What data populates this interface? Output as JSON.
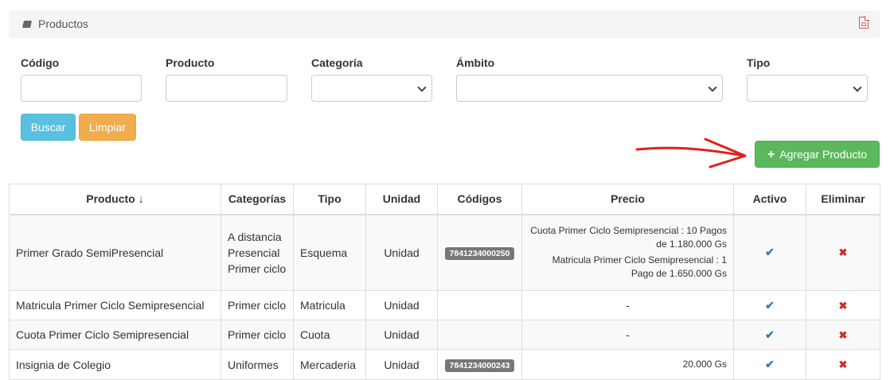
{
  "panel": {
    "title": "Productos",
    "title_icon": "book-icon",
    "export_icon": "file-pdf-icon"
  },
  "filters": {
    "codigo_label": "Código",
    "producto_label": "Producto",
    "categoria_label": "Categoría",
    "ambito_label": "Ámbito",
    "tipo_label": "Tipo",
    "codigo_value": "",
    "producto_value": "",
    "categoria_value": "",
    "ambito_value": "",
    "tipo_value": ""
  },
  "actions": {
    "buscar_label": "Buscar",
    "limpiar_label": "Limpiar",
    "agregar_label": "Agregar Producto",
    "agregar_icon": "plus-icon"
  },
  "annotation": {
    "arrow_color": "#e0201a"
  },
  "colors": {
    "buscar": "#5bc0de",
    "limpiar": "#f0ad4e",
    "agregar": "#5cb85c",
    "badge": "#777777",
    "check": "#337ab7",
    "delete": "#c9302c"
  },
  "table": {
    "headers": {
      "producto": "Producto",
      "producto_sort_icon": "arrow-down-icon",
      "categorias": "Categorías",
      "tipo": "Tipo",
      "unidad": "Unidad",
      "codigos": "Códigos",
      "precio": "Precio",
      "activo": "Activo",
      "eliminar": "Eliminar"
    },
    "rows": [
      {
        "producto": "Primer Grado SemiPresencial",
        "categorias": [
          "A distancia",
          "Presencial",
          "Primer ciclo"
        ],
        "tipo": "Esquema",
        "unidad": "Unidad",
        "codigo": "7841234000250",
        "precio": [
          "Cuota Primer Ciclo Semipresencial : 10 Pagos de 1.180.000 Gs",
          "Matricula Primer Ciclo Semipresencial : 1 Pago de 1.650.000 Gs"
        ]
      },
      {
        "producto": "Matricula Primer Ciclo Semipresencial",
        "categorias": [
          "Primer ciclo"
        ],
        "tipo": "Matricula",
        "unidad": "Unidad",
        "codigo": "",
        "precio": [
          "-"
        ]
      },
      {
        "producto": "Cuota Primer Ciclo Semipresencial",
        "categorias": [
          "Primer ciclo"
        ],
        "tipo": "Cuota",
        "unidad": "Unidad",
        "codigo": "",
        "precio": [
          "-"
        ]
      },
      {
        "producto": "Insignia de Colegio",
        "categorias": [
          "Uniformes"
        ],
        "tipo": "Mercaderia",
        "unidad": "Unidad",
        "codigo": "7841234000243",
        "precio": [
          "20.000 Gs"
        ]
      }
    ]
  }
}
